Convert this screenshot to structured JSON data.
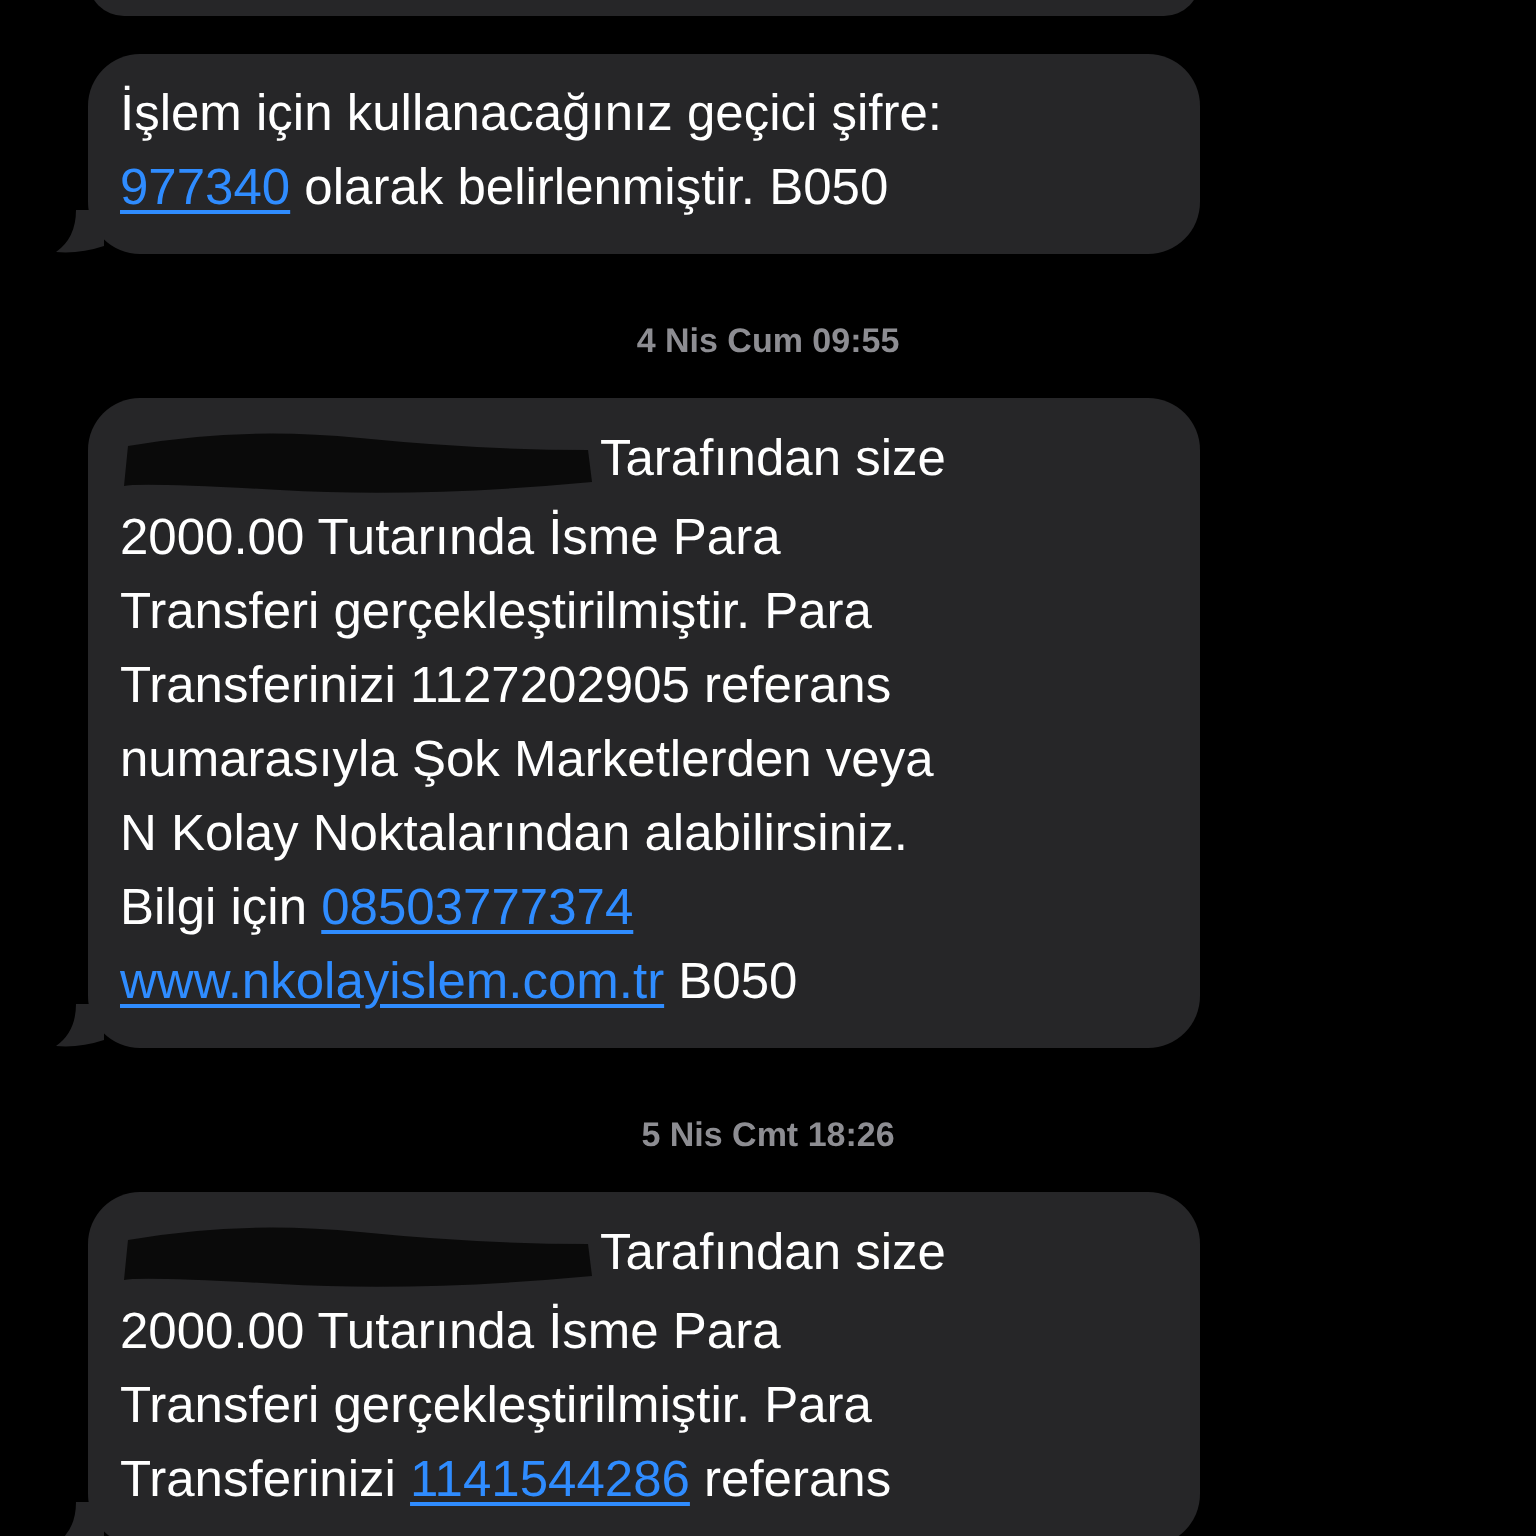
{
  "messages": [
    {
      "kind": "cut"
    },
    {
      "kind": "bubble",
      "redacted": false,
      "lines": [
        [
          {
            "kind": "text",
            "text": "İşlem için kullanacağınız geçici şifre:"
          }
        ],
        [
          {
            "kind": "link",
            "text": "977340"
          },
          {
            "kind": "text",
            "text": " olarak belirlenmiştir. B050"
          }
        ]
      ]
    },
    {
      "kind": "time",
      "text": "4 Nis Cum 09:55"
    },
    {
      "kind": "bubble",
      "redacted": true,
      "lines": [
        [
          {
            "kind": "text",
            "text": "Tarafından size"
          }
        ],
        [
          {
            "kind": "text",
            "text": "2000.00 Tutarında İsme Para"
          }
        ],
        [
          {
            "kind": "text",
            "text": "Transferi gerçekleştirilmiştir. Para"
          }
        ],
        [
          {
            "kind": "text",
            "text": "Transferinizi 1127202905 referans"
          }
        ],
        [
          {
            "kind": "text",
            "text": "numarasıyla Şok Marketlerden veya"
          }
        ],
        [
          {
            "kind": "text",
            "text": "N Kolay Noktalarından alabilirsiniz."
          }
        ],
        [
          {
            "kind": "text",
            "text": "Bilgi için "
          },
          {
            "kind": "link",
            "text": "08503777374"
          }
        ],
        [
          {
            "kind": "link",
            "text": "www.nkolayislem.com.tr"
          },
          {
            "kind": "text",
            "text": " B050"
          }
        ]
      ]
    },
    {
      "kind": "time",
      "text": "5 Nis Cmt 18:26"
    },
    {
      "kind": "bubble",
      "redacted": true,
      "lines": [
        [
          {
            "kind": "text",
            "text": "Tarafından size"
          }
        ],
        [
          {
            "kind": "text",
            "text": "2000.00 Tutarında İsme Para"
          }
        ],
        [
          {
            "kind": "text",
            "text": "Transferi gerçekleştirilmiştir. Para"
          }
        ],
        [
          {
            "kind": "text",
            "text": "Transferinizi "
          },
          {
            "kind": "link",
            "text": "1141544286"
          },
          {
            "kind": "text",
            "text": " referans"
          }
        ]
      ]
    }
  ]
}
